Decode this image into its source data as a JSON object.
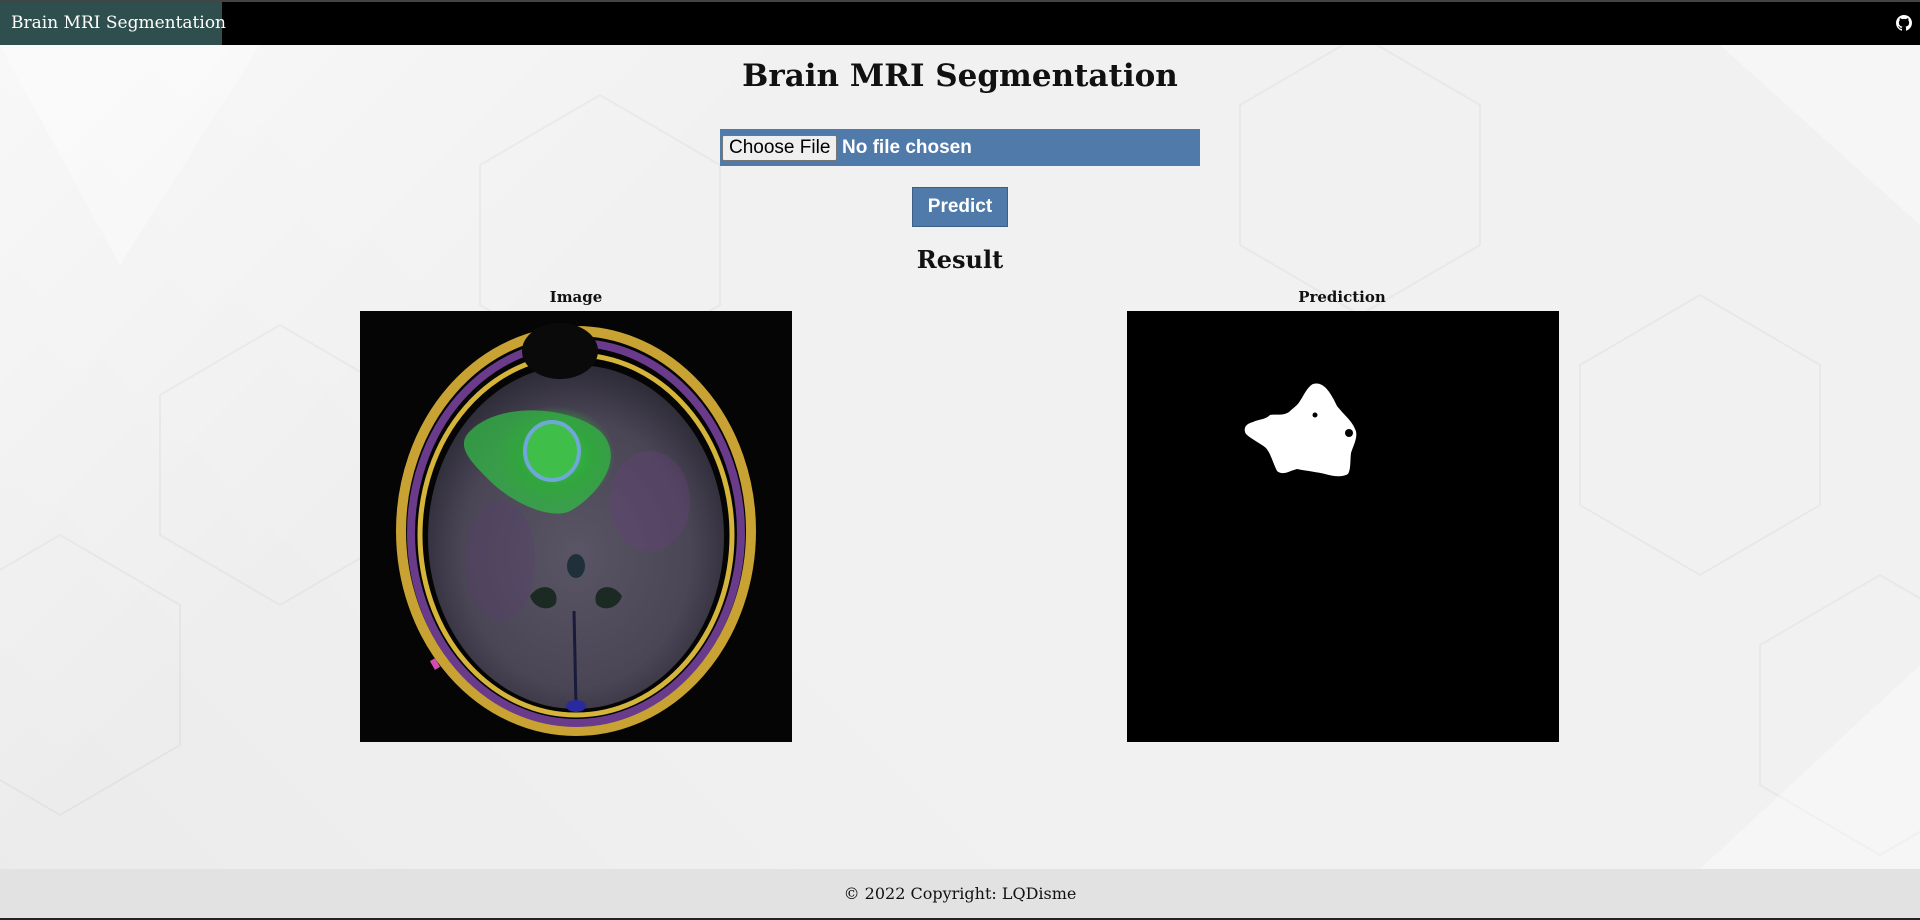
{
  "navbar": {
    "brand": "Brain MRI Segmentation",
    "github_icon": "github-icon"
  },
  "main": {
    "title": "Brain MRI Segmentation",
    "file_input": {
      "button_label": "Choose File",
      "status": "No file chosen"
    },
    "predict_label": "Predict",
    "result_heading": "Result",
    "panels": [
      {
        "caption": "Image"
      },
      {
        "caption": "Prediction"
      }
    ]
  },
  "footer": {
    "text": "© 2022 Copyright: LQDisme"
  },
  "colors": {
    "navbar": "#000000",
    "brand_bg": "#2f4f4f",
    "accent": "#4f7aa9",
    "footer_bg": "#e2e2e2",
    "page_bg": "#f1f1f1"
  }
}
